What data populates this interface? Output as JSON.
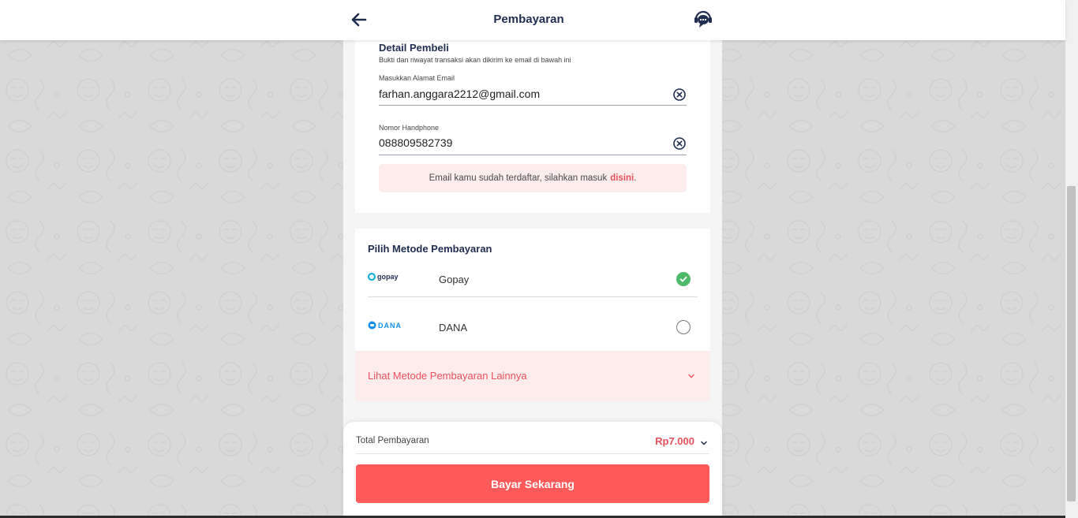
{
  "header": {
    "title": "Pembayaran",
    "back_icon": "arrow-left-icon",
    "support_icon": "chat-support-icon"
  },
  "buyer": {
    "title": "Detail Pembeli",
    "note": "Bukti dan riwayat transaksi akan dikirim ke email di bawah ini",
    "email_label": "Masukkan Alamat Email",
    "email_value": "farhan.anggara2212@gmail.com",
    "phone_label": "Nomor Handphone",
    "phone_value": "088809582739",
    "alert_text": "Email kamu sudah terdaftar, silahkan masuk",
    "alert_link": "disini",
    "alert_end": "."
  },
  "payment": {
    "title": "Pilih Metode Pembayaran",
    "methods": [
      {
        "logo": "gopay",
        "name": "Gopay",
        "selected": true
      },
      {
        "logo": "DANA",
        "name": "DANA",
        "selected": false
      }
    ],
    "more_label": "Lihat Metode Pembayaran Lainnya"
  },
  "footer": {
    "total_label": "Total Pembayaran",
    "total_value": "Rp7.000",
    "pay_button": "Bayar Sekarang"
  },
  "colors": {
    "accent": "#ff5a5a",
    "accent_text": "#e8505b",
    "success": "#4cba69",
    "primary_text": "#1f2d50"
  }
}
